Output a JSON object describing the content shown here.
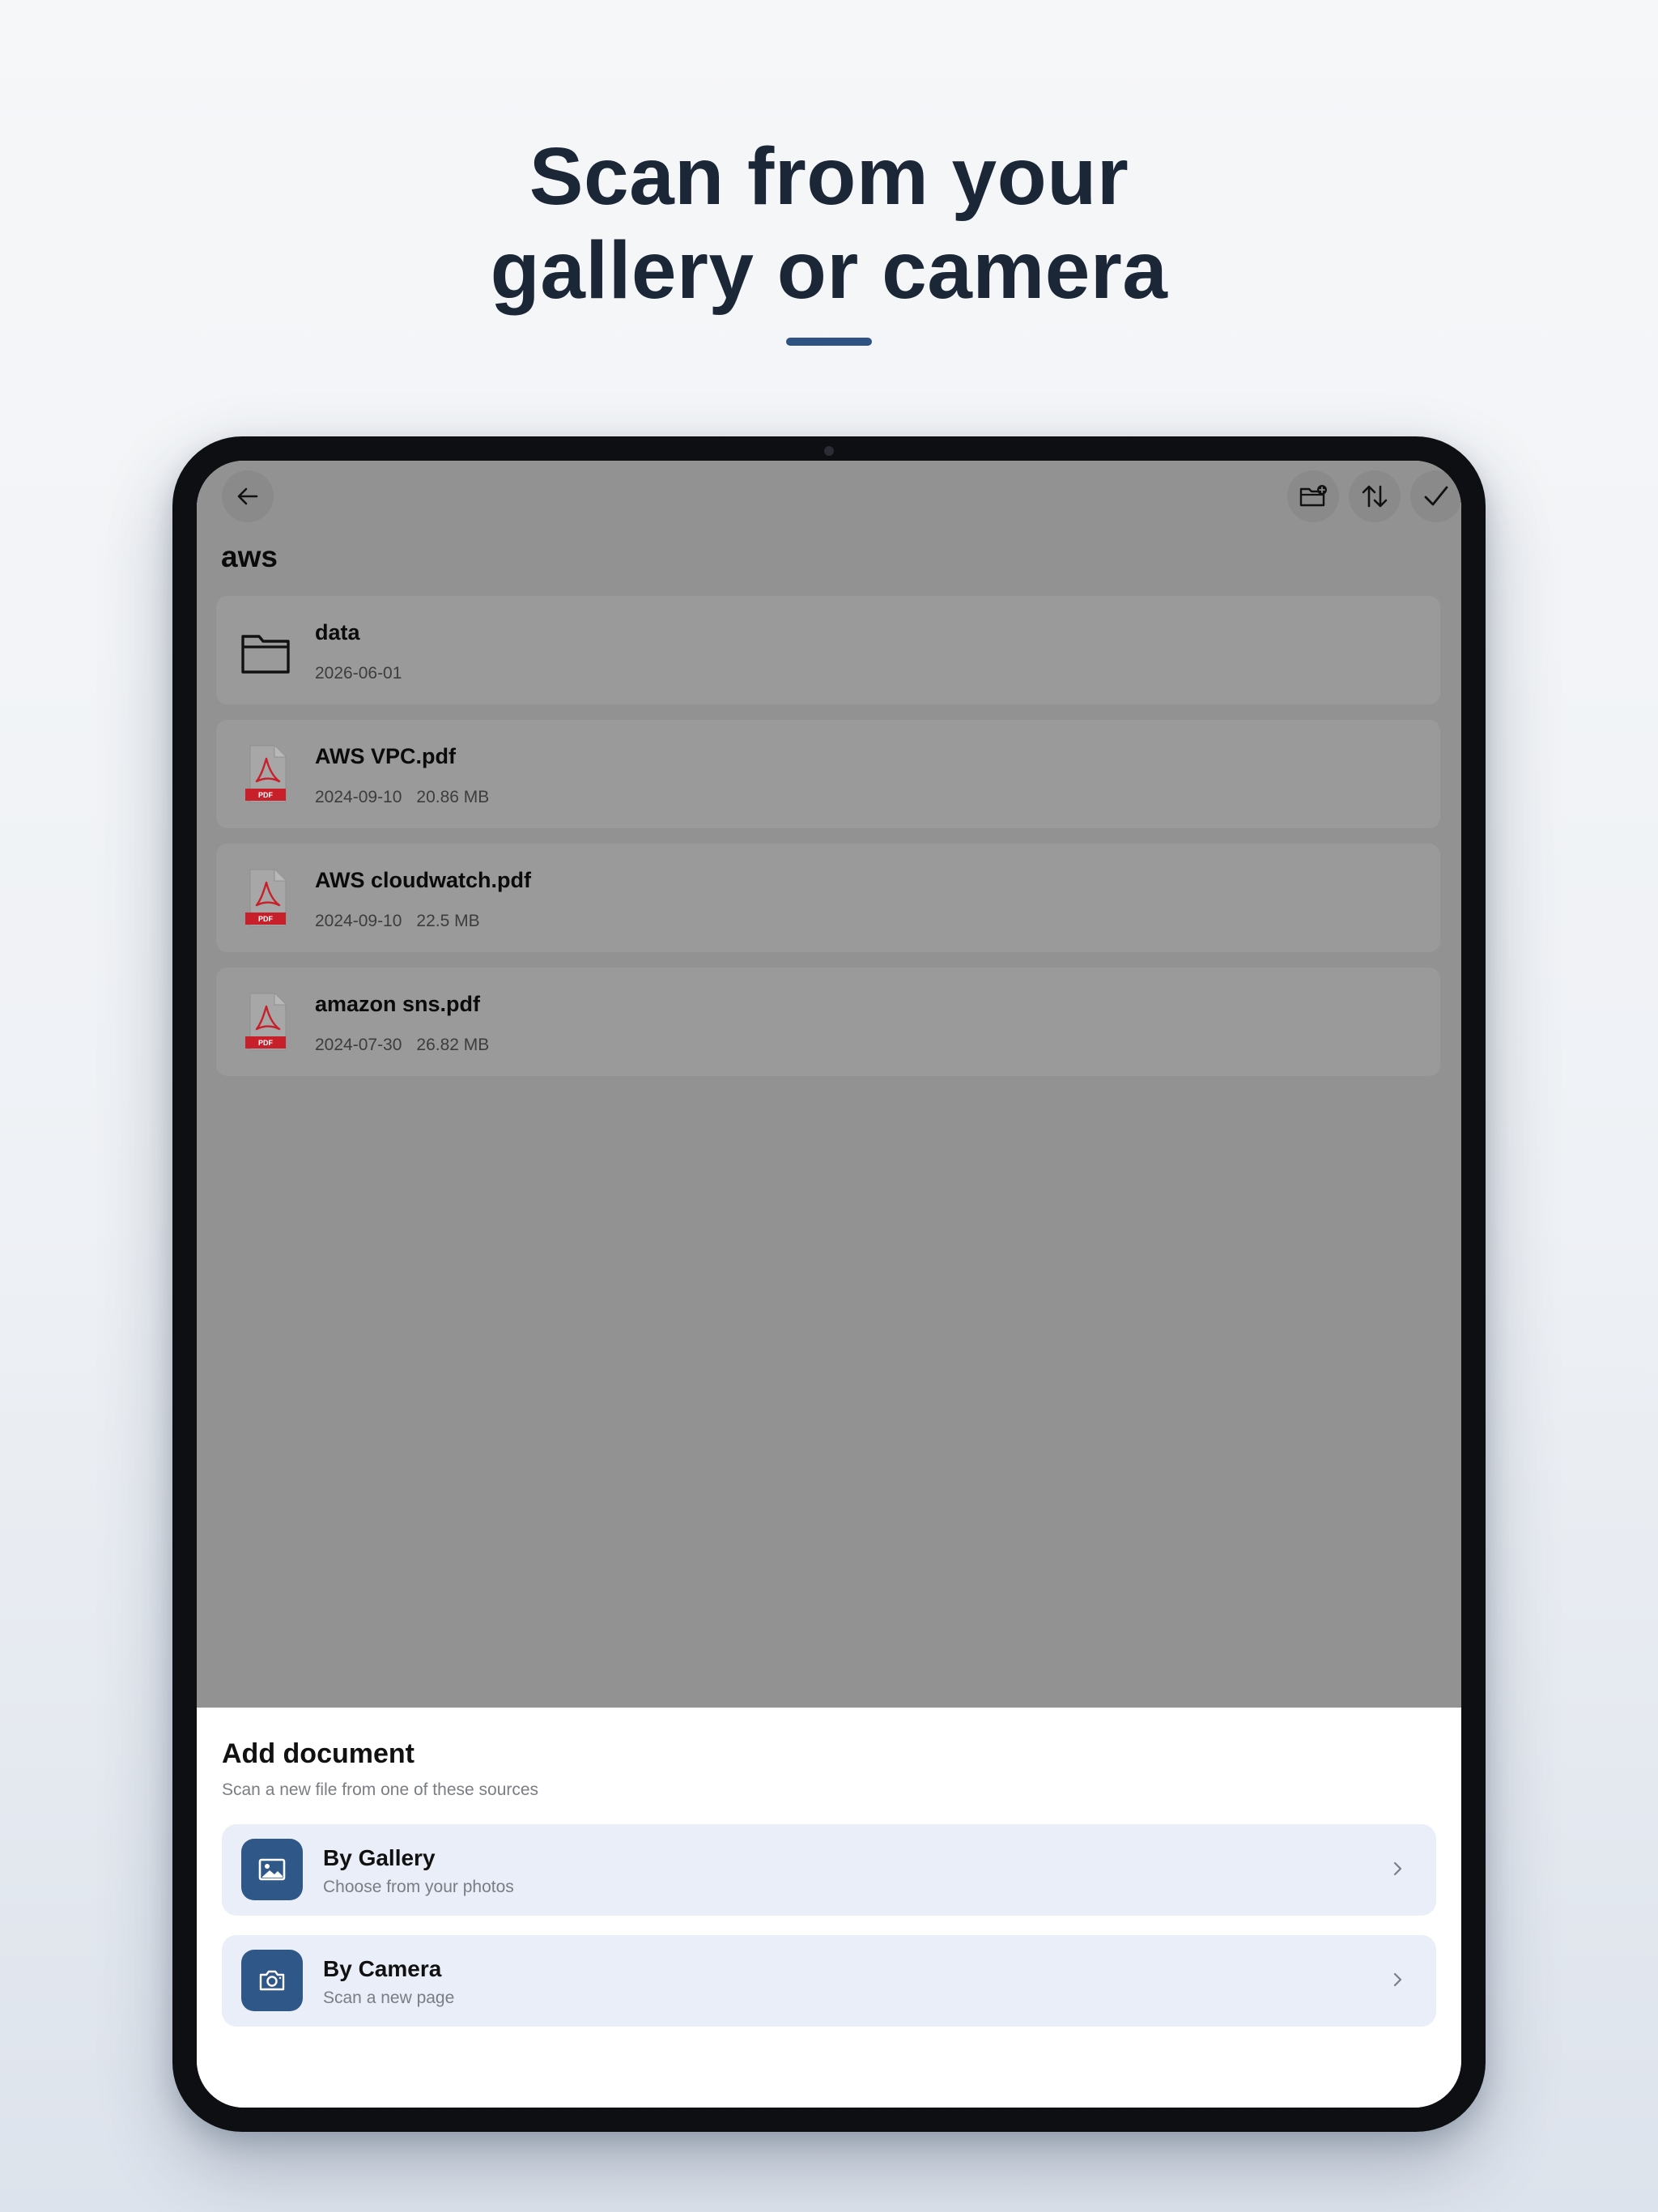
{
  "headline": {
    "line1": "Scan from your",
    "line2": "gallery or camera"
  },
  "colors": {
    "accent": "#2e5282",
    "overlay": "#929293",
    "option_bg": "#e9eef8",
    "option_icon_bg": "#2f5787",
    "pdf_red": "#c8202a"
  },
  "toolbar": {
    "back_icon": "arrow-left-icon",
    "new_folder_icon": "folder-plus-icon",
    "sort_icon": "sort-arrows-icon",
    "select_icon": "checkmark-icon"
  },
  "folder": {
    "title": "aws"
  },
  "files": [
    {
      "name": "data",
      "date": "2026-06-01",
      "size": "",
      "icon": "folder-icon"
    },
    {
      "name": "AWS VPC.pdf",
      "date": "2024-09-10",
      "size": "20.86 MB",
      "icon": "pdf-file-icon"
    },
    {
      "name": "AWS cloudwatch.pdf",
      "date": "2024-09-10",
      "size": "22.5 MB",
      "icon": "pdf-file-icon"
    },
    {
      "name": "amazon sns.pdf",
      "date": "2024-07-30",
      "size": "26.82 MB",
      "icon": "pdf-file-icon"
    }
  ],
  "pdf_badge": "PDF",
  "sheet": {
    "title": "Add document",
    "subtitle": "Scan a new file from one of these sources",
    "options": [
      {
        "title": "By Gallery",
        "description": "Choose from your photos",
        "icon": "image-icon"
      },
      {
        "title": "By Camera",
        "description": "Scan a new page",
        "icon": "camera-icon"
      }
    ]
  }
}
